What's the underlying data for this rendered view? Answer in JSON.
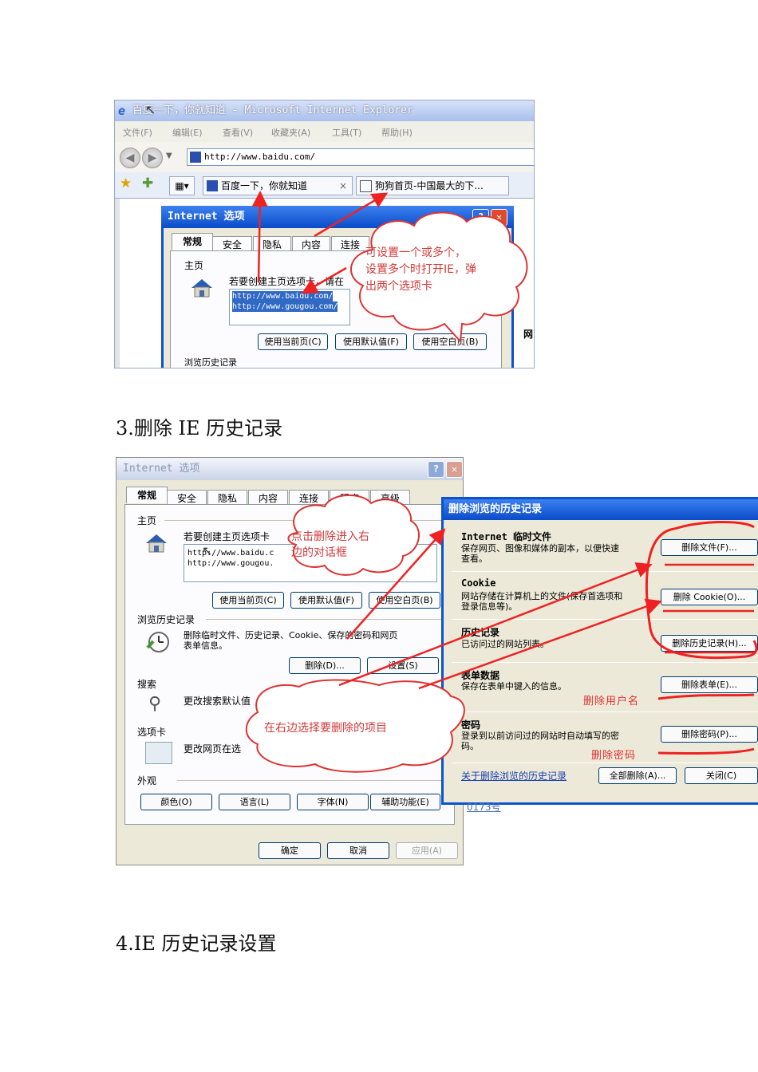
{
  "shot1": {
    "window_title": "百度一下，你就知道 - Microsoft Internet Explorer",
    "menu": [
      "文件(F)",
      "编辑(E)",
      "查看(V)",
      "收藏夹(A)",
      "工具(T)",
      "帮助(H)"
    ],
    "address": "http://www.baidu.com/",
    "tabs": [
      "百度一下，你就知道",
      "狗狗首页-中国最大的下..."
    ],
    "tab_close": "×",
    "dialog": {
      "title": "Internet 选项",
      "tabs": [
        "常规",
        "安全",
        "隐私",
        "内容",
        "连接"
      ],
      "home_label": "主页",
      "home_desc": "若要创建主页选项卡，请在",
      "urls": [
        "http://www.baidu.com/",
        "http://www.gougou.com/"
      ],
      "buttons": [
        "使用当前页(C)",
        "使用默认值(F)",
        "使用空白页(B)"
      ],
      "history_label": "浏览历史记录",
      "right_fragment": "网"
    },
    "callout": [
      "可设置一个或多个，",
      "设置多个时打开IE，弹",
      "出两个选项卡"
    ]
  },
  "heading3": "3.删除 IE 历史记录",
  "shot2": {
    "dialog": {
      "title": "Internet 选项",
      "tabs": [
        "常规",
        "安全",
        "隐私",
        "内容",
        "连接",
        "程序",
        "高级"
      ],
      "home_label": "主页",
      "home_desc": "若要创建主页选项卡",
      "urls": [
        "http://www.baidu.c",
        "http://www.gougou."
      ],
      "home_buttons": [
        "使用当前页(C)",
        "使用默认值(F)",
        "使用空白页(B)"
      ],
      "history_label": "浏览历史记录",
      "history_desc": [
        "删除临时文件、历史记录、Cookie、保存的密码和网页",
        "表单信息。"
      ],
      "history_buttons": [
        "删除(D)...",
        "设置(S)"
      ],
      "search_label": "搜索",
      "search_desc": "更改搜索默认值",
      "tabs_label": "选项卡",
      "tabs_desc": "更改网页在选",
      "appearance_label": "外观",
      "appearance_buttons": [
        "颜色(O)",
        "语言(L)",
        "字体(N)",
        "辅助功能(E)"
      ],
      "footer_buttons": [
        "确定",
        "取消",
        "应用(A)"
      ]
    },
    "callout_top": [
      "点击删除进入右",
      "边的对话框"
    ],
    "callout_bottom": "在右边选择要删除的项目",
    "delete_dialog": {
      "title": "删除浏览的历史记录",
      "sections": [
        {
          "title": "Internet 临时文件",
          "desc": [
            "保存网页、图像和媒体的副本，以便快速",
            "查看。"
          ],
          "button": "删除文件(F)..."
        },
        {
          "title": "Cookie",
          "desc": [
            "网站存储在计算机上的文件(保存首选项和",
            "登录信息等)。"
          ],
          "button": "删除 Cookie(O)..."
        },
        {
          "title": "历史记录",
          "desc": [
            "已访问过的网站列表。"
          ],
          "button": "删除历史记录(H)..."
        },
        {
          "title": "表单数据",
          "desc": [
            "保存在表单中键入的信息。"
          ],
          "button": "删除表单(E)..."
        },
        {
          "title": "密码",
          "desc": [
            "登录到以前访问过的网站时自动填写的密",
            "码。"
          ],
          "button": "删除密码(P)..."
        }
      ],
      "note_form": "删除用户名",
      "note_password": "删除密码",
      "link": "关于删除浏览的历史记录",
      "buttons": [
        "全部删除(A)...",
        "关闭(C)"
      ]
    },
    "bottom_fragment": "0173号"
  },
  "heading4": "4.IE 历史记录设置",
  "colors": {
    "annotation_red": "#e03030",
    "xp_blue": "#0a53d0",
    "dialog_bg": "#ece9d8"
  }
}
